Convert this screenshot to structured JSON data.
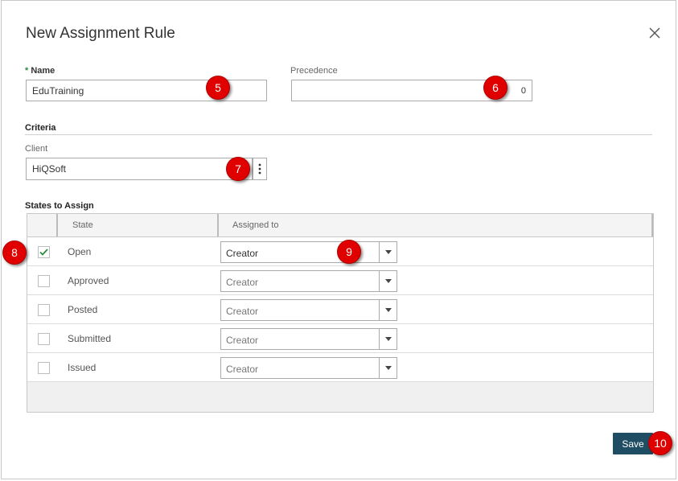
{
  "dialog": {
    "title": "New Assignment Rule"
  },
  "name_field": {
    "required_mark": "*",
    "label": "Name",
    "value": "EduTraining"
  },
  "precedence_field": {
    "label": "Precedence",
    "value": "0"
  },
  "criteria": {
    "title": "Criteria",
    "client_label": "Client",
    "client_value": "HiQSoft",
    "more_icon": "kebab-vertical-icon"
  },
  "states": {
    "title": "States to Assign",
    "columns": [
      "State",
      "Assigned to"
    ],
    "rows": [
      {
        "state": "Open",
        "checked": true,
        "assigned": "Creator"
      },
      {
        "state": "Approved",
        "checked": false,
        "assigned": "Creator"
      },
      {
        "state": "Posted",
        "checked": false,
        "assigned": "Creator"
      },
      {
        "state": "Submitted",
        "checked": false,
        "assigned": "Creator"
      },
      {
        "state": "Issued",
        "checked": false,
        "assigned": "Creator"
      }
    ]
  },
  "footer": {
    "save_label": "Save"
  },
  "callouts": [
    "5",
    "6",
    "7",
    "8",
    "9",
    "10"
  ],
  "colors": {
    "accent": "#1f4d63",
    "callout": "#e00000",
    "required": "#2e8b3e",
    "check": "#2e8b3e"
  }
}
